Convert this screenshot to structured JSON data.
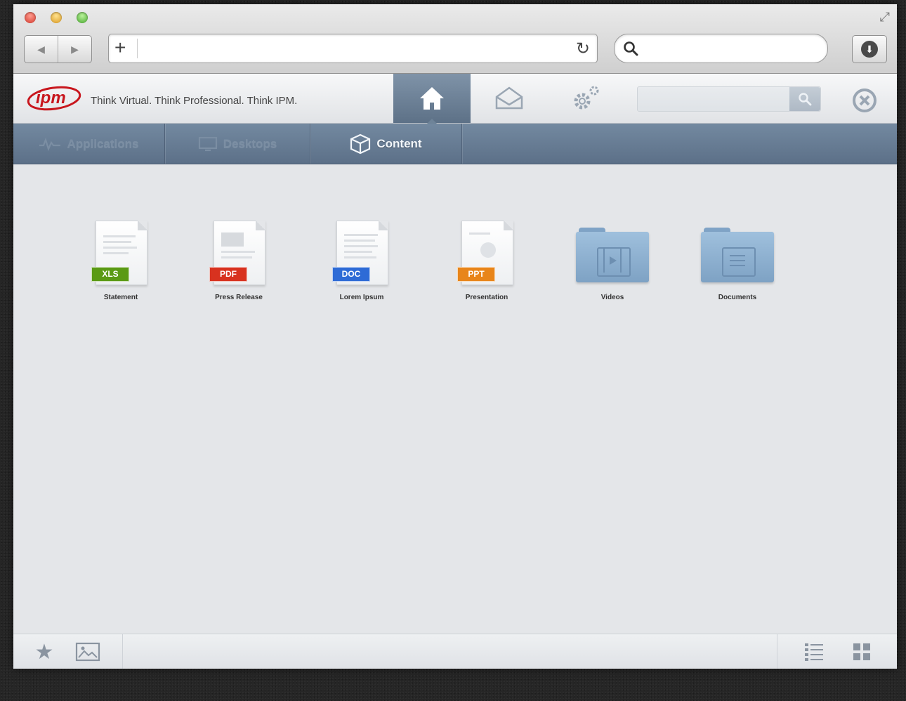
{
  "browser": {
    "nav_back": "◀",
    "nav_forward": "▶",
    "url_value": "",
    "search_value": ""
  },
  "header": {
    "logo_text": "ipm",
    "tagline": "Think Virtual. Think Professional. Think IPM.",
    "search_value": "",
    "active_button": "home"
  },
  "tabs": [
    {
      "label": "Applications",
      "icon": "applications-icon",
      "active": false
    },
    {
      "label": "Desktops",
      "icon": "desktop-icon",
      "active": false
    },
    {
      "label": "Content",
      "icon": "box-icon",
      "active": true
    }
  ],
  "items": [
    {
      "type": "file",
      "badge": "XLS",
      "badge_color": "#5a9a14",
      "label": "Statement"
    },
    {
      "type": "file",
      "badge": "PDF",
      "badge_color": "#d8321f",
      "label": "Press Release"
    },
    {
      "type": "file",
      "badge": "DOC",
      "badge_color": "#2e6bd6",
      "label": "Lorem Ipsum"
    },
    {
      "type": "file",
      "badge": "PPT",
      "badge_color": "#e8851a",
      "label": "Presentation"
    },
    {
      "type": "folder",
      "label": "Videos",
      "icon": "video-folder-icon"
    },
    {
      "type": "folder",
      "label": "Documents",
      "icon": "documents-folder-icon"
    }
  ],
  "colors": {
    "active_tab": "#6e8398",
    "subnav": "#687d94",
    "logo_red": "#c8161d"
  }
}
